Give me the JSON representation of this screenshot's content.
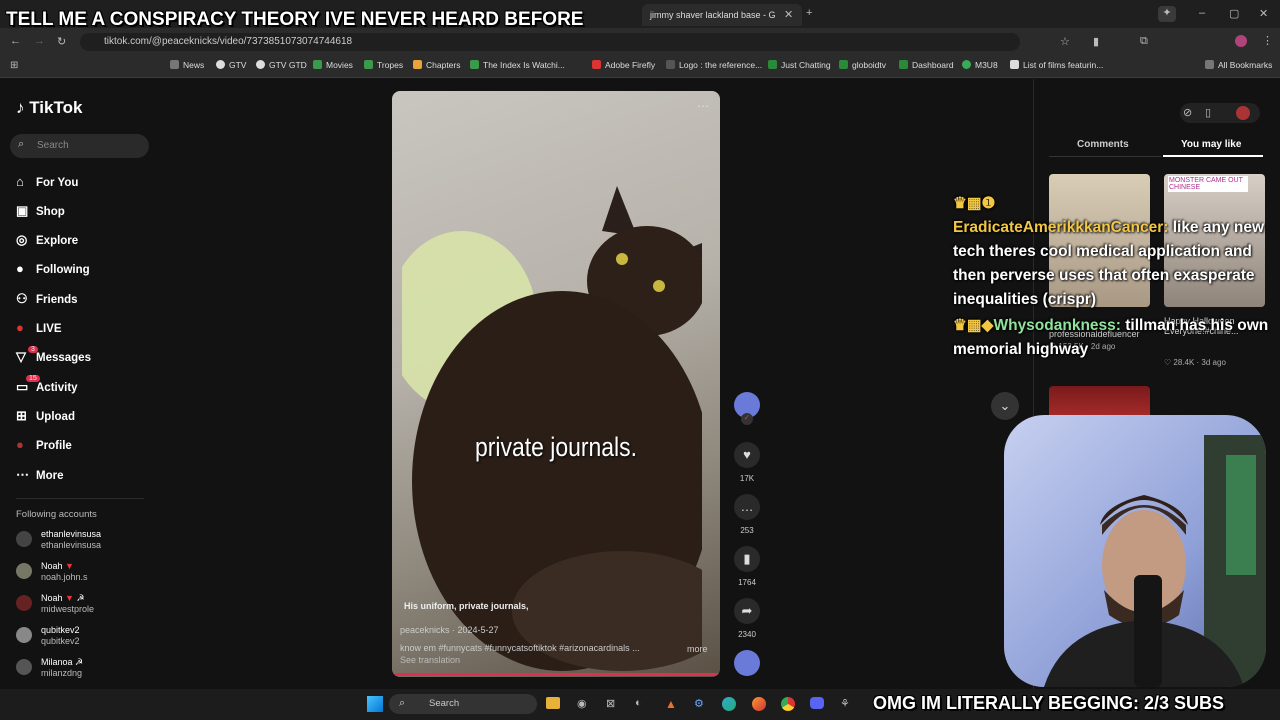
{
  "browser": {
    "tabs": [
      "jimmy shaver lackland base - G"
    ],
    "url": "tiktok.com/@peaceknicks/video/7373851073074744618",
    "bookmarks": [
      "News",
      "GTV",
      "GTV GTD",
      "Movies",
      "Tropes",
      "Chapters",
      "The Index Is Watchi...",
      "Adobe Firefly",
      "Logo : the reference...",
      "Just Chatting",
      "globoidtv",
      "Dashboard",
      "M3U8",
      "List of films featurin..."
    ],
    "all_bookmarks": "All Bookmarks"
  },
  "tiktok": {
    "logo": "TikTok",
    "search_placeholder": "Search",
    "nav": [
      "For You",
      "Shop",
      "Explore",
      "Following",
      "Friends",
      "LIVE",
      "Messages",
      "Activity",
      "Upload",
      "Profile",
      "More"
    ],
    "messages_badge": "3",
    "activity_badge": "15",
    "following_header": "Following accounts",
    "accounts": [
      {
        "name": "ethanlevinsusa",
        "handle": "ethanlevinsusa"
      },
      {
        "name": "Noah",
        "handle": "noah.john.s"
      },
      {
        "name": "Noah",
        "handle": "midwestprole"
      },
      {
        "name": "qubitkev2",
        "handle": "qubitkev2"
      },
      {
        "name": "Milanoa",
        "handle": "milanzdng"
      }
    ],
    "video": {
      "caption_overlay": "private journals.",
      "subtitle": "His uniform, private journals,",
      "author": "peaceknicks · 2024-5-27",
      "desc": "know em #funnycats #funnycatsoftiktok #arizonacardinals ...",
      "more": "more",
      "see_translation": "See translation"
    },
    "actions": {
      "likes": "17K",
      "comments": "253",
      "saves": "1764",
      "shares": "2340"
    },
    "right_tabs": [
      "Comments",
      "You may like"
    ],
    "suggestions": [
      {
        "user": "professionaldefluencer",
        "likes": "152.5K",
        "ago": "2d ago",
        "badge": ""
      },
      {
        "user": "Happy Halloween Everyone!#chine...",
        "likes": "28.4K",
        "ago": "3d ago",
        "badge": "MONSTER CAME OUT CHINESE"
      }
    ]
  },
  "overlay": {
    "top_banner": "TELL ME A CONSPIRACY THEORY IVE NEVER HEARD BEFORE",
    "chat": [
      {
        "user": "EradicateAmerikkkanCancer:",
        "user_color": "#f2c744",
        "msg": "like any new tech theres cool medical application and then perverse uses that often exasperate inequalities (crispr)"
      },
      {
        "user": "Whysodankness:",
        "user_color": "#8fe39a",
        "msg": "tillman has his own memorial highway"
      }
    ],
    "bottom_banner": "OMG IM LITERALLY BEGGING: 2/3 SUBS"
  },
  "taskbar": {
    "search_placeholder": "Search"
  }
}
